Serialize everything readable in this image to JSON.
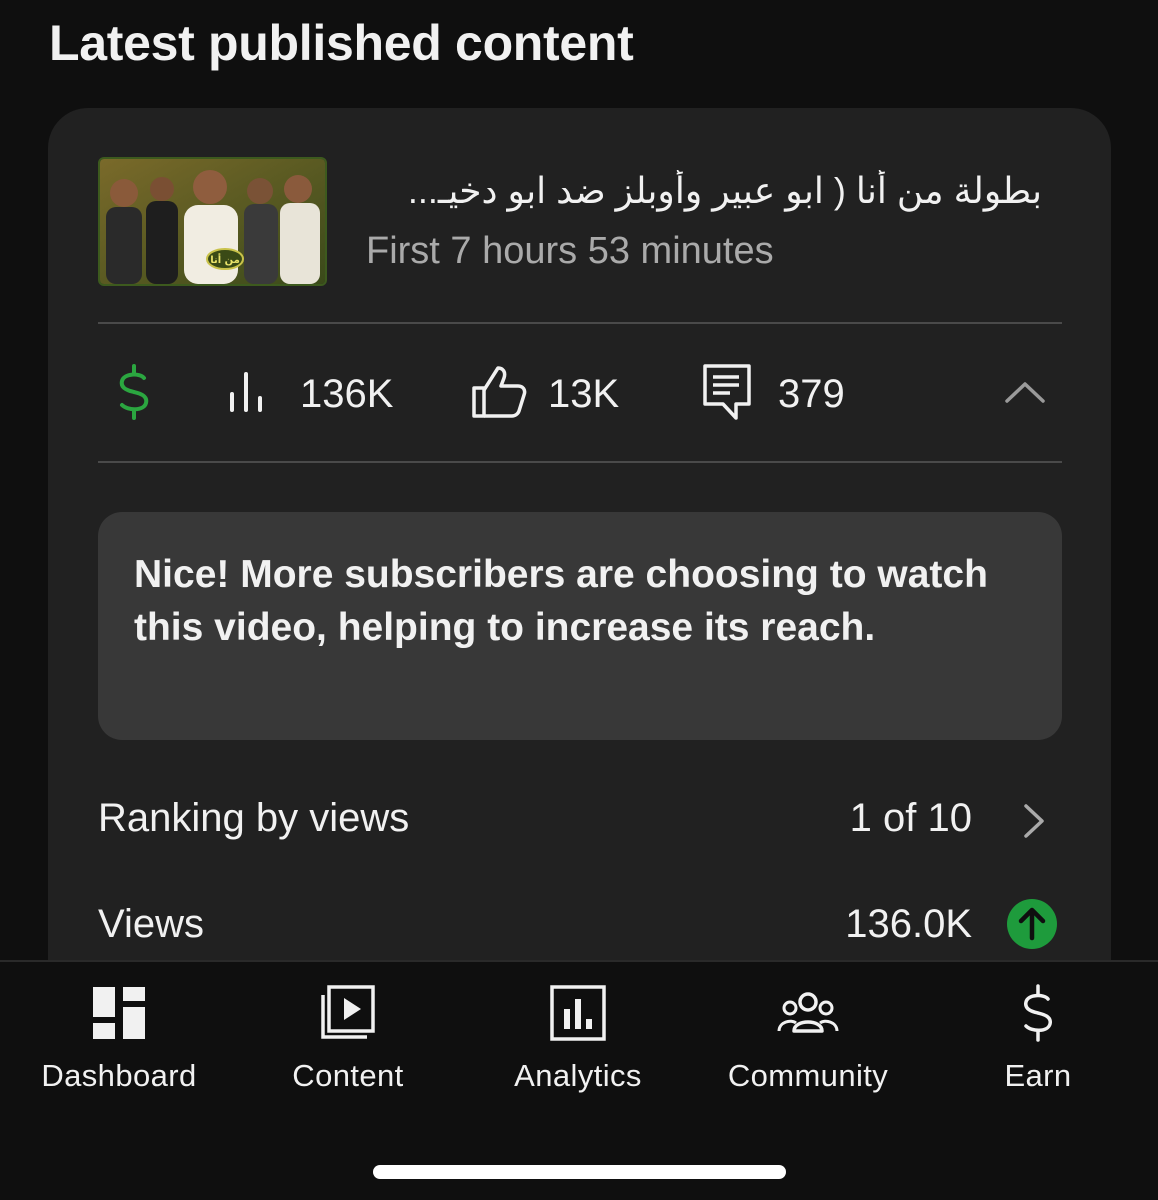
{
  "section": {
    "title": "Latest published content"
  },
  "video": {
    "title": "بطولة من أنا ( ابو عبير وأوبلز ضد ابو دخيـ...",
    "subtitle": "First 7 hours 53 minutes",
    "thumbnail_badge": "من أنا"
  },
  "stats": {
    "views": "136K",
    "likes": "13K",
    "comments": "379"
  },
  "insight": {
    "text": "Nice! More subscribers are choosing to watch this video, helping to increase its reach."
  },
  "metrics": [
    {
      "label": "Ranking by views",
      "value": "1 of 10"
    },
    {
      "label": "Views",
      "value": "136.0K"
    }
  ],
  "nav": {
    "items": [
      {
        "label": "Dashboard",
        "icon": "dashboard-icon"
      },
      {
        "label": "Content",
        "icon": "content-icon"
      },
      {
        "label": "Analytics",
        "icon": "analytics-icon"
      },
      {
        "label": "Community",
        "icon": "community-icon"
      },
      {
        "label": "Earn",
        "icon": "dollar-icon"
      }
    ]
  },
  "colors": {
    "background": "#0f0f0f",
    "card": "#212121",
    "insight_box": "#383838",
    "accent_green": "#1e9b3c",
    "monetization_green": "#2ba640",
    "secondary_text": "#aaaaaa"
  }
}
